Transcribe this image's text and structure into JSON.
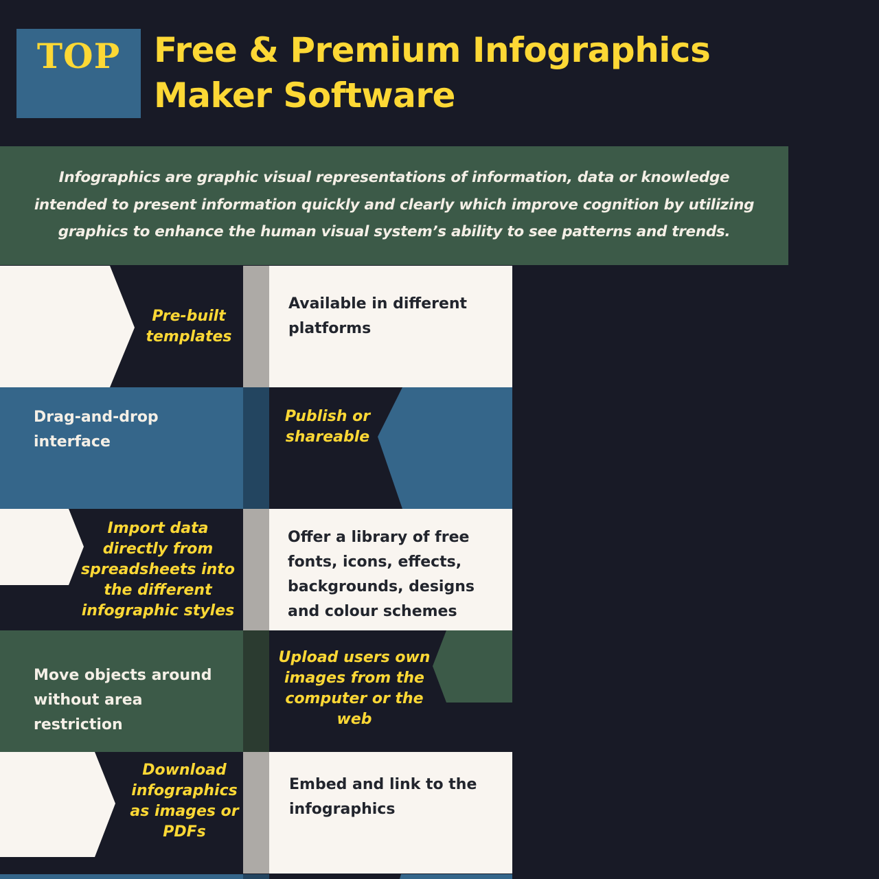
{
  "header": {
    "badge": "TOP",
    "title_line1": "Free & Premium Infographics",
    "title_line2": "Maker Software"
  },
  "intro": {
    "text": "Infographics are graphic visual representations of information, data or knowledge intended to present information quickly and clearly which improve cognition by utilizing graphics to enhance the human visual system’s ability to see patterns and trends."
  },
  "features": [
    {
      "left": "Pre-built templates",
      "right": "Available in different platforms"
    },
    {
      "left": "Drag-and-drop interface",
      "right": "Publish or shareable"
    },
    {
      "left": "Import data directly from spreadsheets into the different infographic styles",
      "right": "Offer a library of free fonts, icons, effects, backgrounds, designs and colour schemes"
    },
    {
      "left": "Move objects around without area restriction",
      "right": "Upload users own images from the computer or the web"
    },
    {
      "left": "Download infographics as images or PDFs",
      "right": "Embed and link to the infographics"
    }
  ],
  "colors": {
    "background": "#181a26",
    "accent_yellow": "#fdd835",
    "blue": "#35668a",
    "green": "#3c5a48",
    "cream": "#f9f5f0",
    "spine_gray": "#adaaa6"
  }
}
